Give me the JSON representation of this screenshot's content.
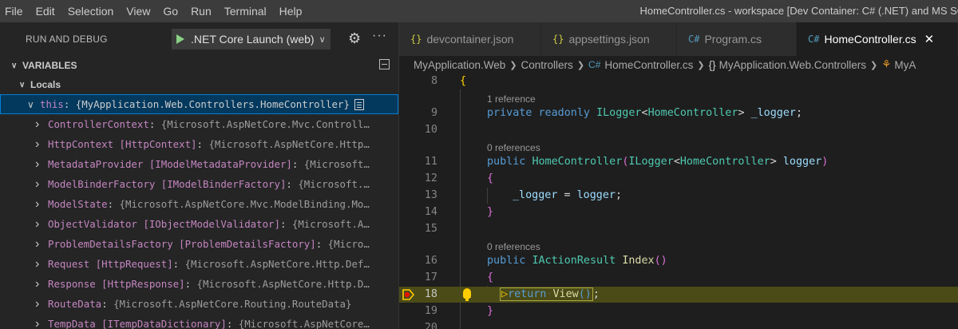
{
  "menu": [
    "File",
    "Edit",
    "Selection",
    "View",
    "Go",
    "Run",
    "Terminal",
    "Help"
  ],
  "window_title": "HomeController.cs - workspace [Dev Container: C# (.NET) and MS SQL] - V",
  "debug": {
    "title": "RUN AND DEBUG",
    "config": ".NET Core Launch (web)"
  },
  "variables": {
    "header": "VARIABLES",
    "locals": "Locals",
    "this_name": "this",
    "this_value": "{MyApplication.Web.Controllers.HomeController}",
    "children": [
      {
        "name": "ControllerContext",
        "type": "",
        "value": "{Microsoft.AspNetCore.Mvc.Controll…"
      },
      {
        "name": "HttpContext",
        "type": "[HttpContext]",
        "value": "{Microsoft.AspNetCore.Http…"
      },
      {
        "name": "MetadataProvider",
        "type": "[IModelMetadataProvider]",
        "value": "{Microsoft…"
      },
      {
        "name": "ModelBinderFactory",
        "type": "[IModelBinderFactory]",
        "value": "{Microsoft.…"
      },
      {
        "name": "ModelState",
        "type": "",
        "value": "{Microsoft.AspNetCore.Mvc.ModelBinding.Mo…"
      },
      {
        "name": "ObjectValidator",
        "type": "[IObjectModelValidator]",
        "value": "{Microsoft.A…"
      },
      {
        "name": "ProblemDetailsFactory",
        "type": "[ProblemDetailsFactory]",
        "value": "{Micro…"
      },
      {
        "name": "Request",
        "type": "[HttpRequest]",
        "value": "{Microsoft.AspNetCore.Http.Def…"
      },
      {
        "name": "Response",
        "type": "[HttpResponse]",
        "value": "{Microsoft.AspNetCore.Http.D…"
      },
      {
        "name": "RouteData",
        "type": "",
        "value": "{Microsoft.AspNetCore.Routing.RouteData}"
      },
      {
        "name": "TempData",
        "type": "[ITempDataDictionary]",
        "value": "{Microsoft.AspNetCore…"
      }
    ]
  },
  "tabs": [
    {
      "label": "devcontainer.json",
      "icon": "{}"
    },
    {
      "label": "appsettings.json",
      "icon": "{}"
    },
    {
      "label": "Program.cs",
      "icon": "C#"
    },
    {
      "label": "HomeController.cs",
      "icon": "C#"
    }
  ],
  "breadcrumb": {
    "project": "MyApplication.Web",
    "folder": "Controllers",
    "file": "HomeController.cs",
    "namespace": "MyApplication.Web.Controllers",
    "class": "MyA"
  },
  "code": {
    "line_numbers": [
      "8",
      "9",
      "10",
      "11",
      "12",
      "13",
      "14",
      "15",
      "16",
      "17",
      "18",
      "19",
      "20"
    ],
    "lens_1": "1 reference",
    "lens_2": "0 references",
    "lens_3": "0 references",
    "line9": {
      "kw1": "private",
      "kw2": "readonly",
      "type": "ILogger",
      "generic": "HomeController",
      "field": "_logger"
    },
    "line11": {
      "kw": "public",
      "fn": "HomeController",
      "type": "ILogger",
      "generic": "HomeController",
      "param": "logger"
    },
    "line13": {
      "left": "_logger",
      "right": "logger"
    },
    "line16": {
      "kw": "public",
      "type": "IActionResult",
      "fn": "Index"
    },
    "line18": {
      "kw": "return",
      "fn": "View"
    }
  }
}
